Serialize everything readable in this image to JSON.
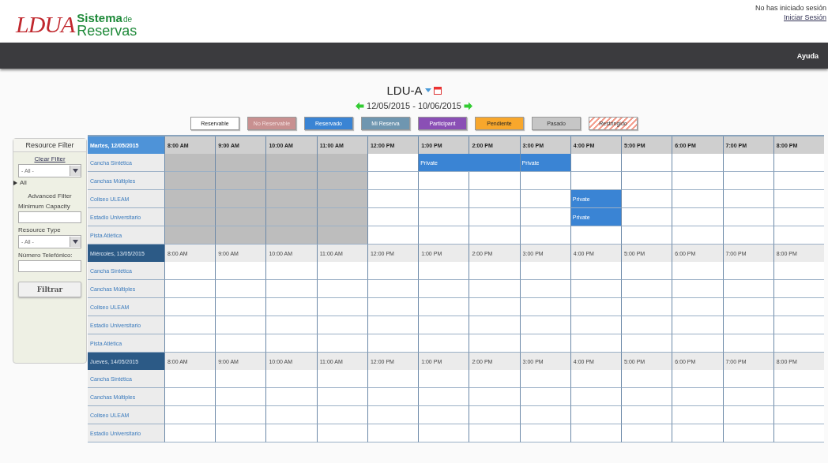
{
  "logo": {
    "mark": "LDUA",
    "title": "Sistema",
    "title_suffix": "de",
    "subtitle": "Reservas"
  },
  "user": {
    "status": "No has iniciado sesión",
    "login_link": "Iniciar Sesión"
  },
  "nav": {
    "items": [
      "Ayuda"
    ]
  },
  "schedule": {
    "title": "LDU-A",
    "date_range": "12/05/2015 - 10/06/2015"
  },
  "legend": [
    {
      "label": "Reservable",
      "kind": "reservable"
    },
    {
      "label": "No Reservable",
      "kind": "unreservable"
    },
    {
      "label": "Reservado",
      "kind": "reserved"
    },
    {
      "label": "Mi Reserva",
      "kind": "mine"
    },
    {
      "label": "Participant",
      "kind": "participant"
    },
    {
      "label": "Pendiente",
      "kind": "pending"
    },
    {
      "label": "Pasado",
      "kind": "past"
    },
    {
      "label": "Restringido",
      "kind": "restricted"
    }
  ],
  "filter": {
    "title": "Resource Filter",
    "clear_link": "Clear Filter",
    "resource_select": "- All -",
    "tree": [
      {
        "label": "All",
        "expanded": false
      }
    ],
    "advanced_title": "Advanced Filter",
    "min_capacity_label": "Minimum Capacity",
    "resource_type_label": "Resource Type",
    "resource_type_select": "- All -",
    "phone_label": "Número Telefónico:",
    "button": "Filtrar"
  },
  "days": [
    {
      "label": "Martes, 12/05/2015",
      "current": true,
      "hours": [
        "8:00 AM",
        "9:00 AM",
        "10:00 AM",
        "11:00 AM",
        "12:00 PM",
        "1:00 PM",
        "2:00 PM",
        "3:00 PM",
        "4:00 PM",
        "5:00 PM",
        "6:00 PM",
        "7:00 PM",
        "8:00 PM"
      ],
      "rows": [
        {
          "name": "Cancha Sintética",
          "cells": [
            {
              "kind": "past"
            },
            {
              "kind": "past"
            },
            {
              "kind": "past"
            },
            {
              "kind": "past"
            },
            {
              "kind": "free"
            },
            {
              "kind": "reserved",
              "text": "Private"
            },
            {
              "kind": "reserved"
            },
            {
              "kind": "reserved",
              "text": "Private"
            },
            {
              "kind": "free"
            },
            {
              "kind": "free"
            },
            {
              "kind": "free"
            },
            {
              "kind": "free"
            },
            {
              "kind": "free"
            }
          ]
        },
        {
          "name": "Canchas Múltiples",
          "cells": [
            {
              "kind": "past"
            },
            {
              "kind": "past"
            },
            {
              "kind": "past"
            },
            {
              "kind": "past"
            },
            {
              "kind": "free"
            },
            {
              "kind": "free"
            },
            {
              "kind": "free"
            },
            {
              "kind": "free"
            },
            {
              "kind": "free"
            },
            {
              "kind": "free"
            },
            {
              "kind": "free"
            },
            {
              "kind": "free"
            },
            {
              "kind": "free"
            }
          ]
        },
        {
          "name": "Coliseo ULEAM",
          "cells": [
            {
              "kind": "past"
            },
            {
              "kind": "past"
            },
            {
              "kind": "past"
            },
            {
              "kind": "past"
            },
            {
              "kind": "free"
            },
            {
              "kind": "free"
            },
            {
              "kind": "free"
            },
            {
              "kind": "free"
            },
            {
              "kind": "reserved",
              "text": "Private"
            },
            {
              "kind": "free"
            },
            {
              "kind": "free"
            },
            {
              "kind": "free"
            },
            {
              "kind": "free"
            }
          ]
        },
        {
          "name": "Estadio Universitario",
          "cells": [
            {
              "kind": "past"
            },
            {
              "kind": "past"
            },
            {
              "kind": "past"
            },
            {
              "kind": "past"
            },
            {
              "kind": "free"
            },
            {
              "kind": "free"
            },
            {
              "kind": "free"
            },
            {
              "kind": "free"
            },
            {
              "kind": "reserved",
              "text": "Private"
            },
            {
              "kind": "free"
            },
            {
              "kind": "free"
            },
            {
              "kind": "free"
            },
            {
              "kind": "free"
            }
          ]
        },
        {
          "name": "Pista Atlética",
          "cells": [
            {
              "kind": "past"
            },
            {
              "kind": "past"
            },
            {
              "kind": "past"
            },
            {
              "kind": "past"
            },
            {
              "kind": "free"
            },
            {
              "kind": "free"
            },
            {
              "kind": "free"
            },
            {
              "kind": "free"
            },
            {
              "kind": "free"
            },
            {
              "kind": "free"
            },
            {
              "kind": "free"
            },
            {
              "kind": "free"
            },
            {
              "kind": "free"
            }
          ]
        }
      ]
    },
    {
      "label": "Miércoles, 13/05/2015",
      "current": false,
      "hours": [
        "8:00 AM",
        "9:00 AM",
        "10:00 AM",
        "11:00 AM",
        "12:00 PM",
        "1:00 PM",
        "2:00 PM",
        "3:00 PM",
        "4:00 PM",
        "5:00 PM",
        "6:00 PM",
        "7:00 PM",
        "8:00 PM"
      ],
      "rows": [
        {
          "name": "Cancha Sintética",
          "cells": []
        },
        {
          "name": "Canchas Múltiples",
          "cells": []
        },
        {
          "name": "Coliseo ULEAM",
          "cells": []
        },
        {
          "name": "Estadio Universitario",
          "cells": []
        },
        {
          "name": "Pista Atlética",
          "cells": []
        }
      ]
    },
    {
      "label": "Jueves, 14/05/2015",
      "current": false,
      "hours": [
        "8:00 AM",
        "9:00 AM",
        "10:00 AM",
        "11:00 AM",
        "12:00 PM",
        "1:00 PM",
        "2:00 PM",
        "3:00 PM",
        "4:00 PM",
        "5:00 PM",
        "6:00 PM",
        "7:00 PM",
        "8:00 PM"
      ],
      "rows": [
        {
          "name": "Cancha Sintética",
          "cells": []
        },
        {
          "name": "Canchas Múltiples",
          "cells": []
        },
        {
          "name": "Coliseo ULEAM",
          "cells": []
        },
        {
          "name": "Estadio Universitario",
          "cells": []
        }
      ]
    }
  ]
}
